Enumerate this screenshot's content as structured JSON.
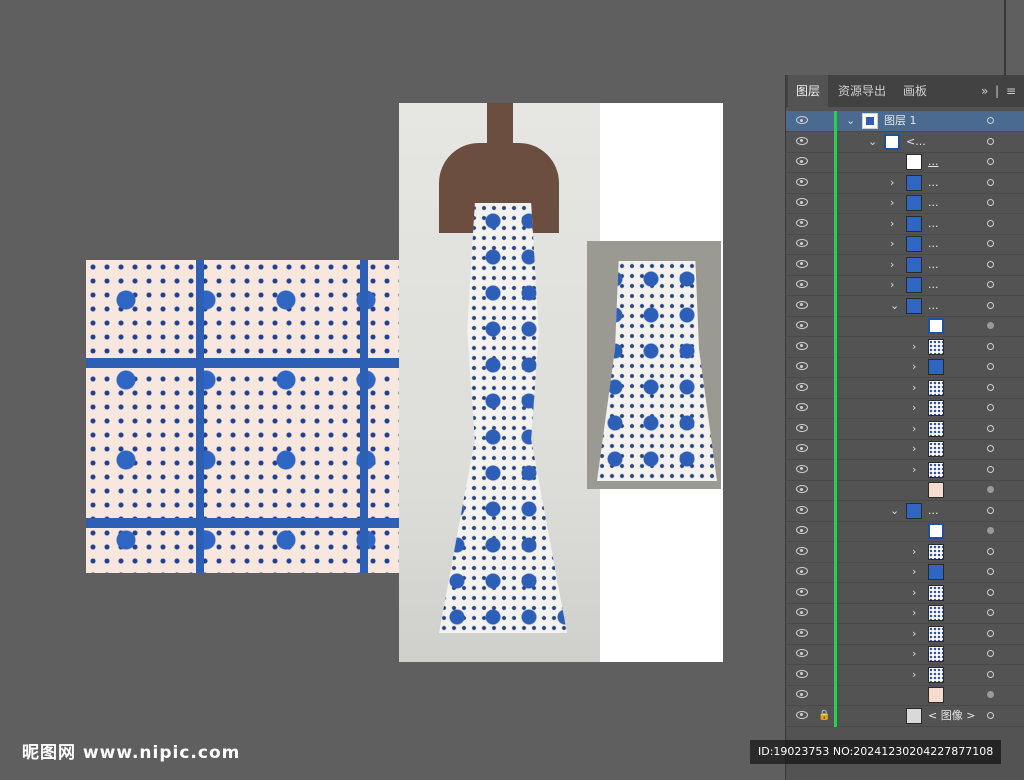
{
  "panel": {
    "tabs": [
      "图层",
      "资源导出",
      "画板"
    ],
    "active_tab": "图层",
    "menu_expand": "»",
    "menu_sep": "|",
    "menu_icon": "≡"
  },
  "layers": [
    {
      "indent": 0,
      "chev": "⌄",
      "thumb": "layer",
      "name": "图层  1",
      "selected": true,
      "target": "ring"
    },
    {
      "indent": 1,
      "chev": "⌄",
      "thumb": "group",
      "name": "<...",
      "target": "ring"
    },
    {
      "indent": 2,
      "chev": "",
      "thumb": "white",
      "name": "...",
      "underline": true,
      "target": "ring"
    },
    {
      "indent": 2,
      "chev": "›",
      "thumb": "blue",
      "name": "...",
      "target": "ring"
    },
    {
      "indent": 2,
      "chev": "›",
      "thumb": "blue",
      "name": "...",
      "target": "ring"
    },
    {
      "indent": 2,
      "chev": "›",
      "thumb": "blue",
      "name": "...",
      "target": "ring"
    },
    {
      "indent": 2,
      "chev": "›",
      "thumb": "blue",
      "name": "...",
      "target": "ring"
    },
    {
      "indent": 2,
      "chev": "›",
      "thumb": "blue",
      "name": "...",
      "target": "ring"
    },
    {
      "indent": 2,
      "chev": "›",
      "thumb": "blue",
      "name": "...",
      "target": "ring"
    },
    {
      "indent": 2,
      "chev": "⌄",
      "thumb": "blue",
      "name": "...",
      "target": "ring"
    },
    {
      "indent": 3,
      "chev": "",
      "thumb": "group",
      "name": "",
      "target": "filled"
    },
    {
      "indent": 3,
      "chev": "›",
      "thumb": "dots",
      "name": "",
      "target": "ring"
    },
    {
      "indent": 3,
      "chev": "›",
      "thumb": "blue",
      "name": "",
      "target": "ring"
    },
    {
      "indent": 3,
      "chev": "›",
      "thumb": "dots",
      "name": "",
      "target": "ring"
    },
    {
      "indent": 3,
      "chev": "›",
      "thumb": "dots",
      "name": "",
      "target": "ring"
    },
    {
      "indent": 3,
      "chev": "›",
      "thumb": "dots",
      "name": "",
      "target": "ring"
    },
    {
      "indent": 3,
      "chev": "›",
      "thumb": "dots",
      "name": "",
      "target": "ring"
    },
    {
      "indent": 3,
      "chev": "›",
      "thumb": "dots",
      "name": "",
      "target": "ring"
    },
    {
      "indent": 3,
      "chev": "",
      "thumb": "peach",
      "name": "",
      "target": "filled"
    },
    {
      "indent": 2,
      "chev": "⌄",
      "thumb": "blue",
      "name": "...",
      "target": "ring"
    },
    {
      "indent": 3,
      "chev": "",
      "thumb": "group",
      "name": "",
      "target": "filled"
    },
    {
      "indent": 3,
      "chev": "›",
      "thumb": "dots",
      "name": "",
      "target": "ring"
    },
    {
      "indent": 3,
      "chev": "›",
      "thumb": "blue",
      "name": "",
      "target": "ring"
    },
    {
      "indent": 3,
      "chev": "›",
      "thumb": "dots",
      "name": "",
      "target": "ring"
    },
    {
      "indent": 3,
      "chev": "›",
      "thumb": "dots",
      "name": "",
      "target": "ring"
    },
    {
      "indent": 3,
      "chev": "›",
      "thumb": "dots",
      "name": "",
      "target": "ring"
    },
    {
      "indent": 3,
      "chev": "›",
      "thumb": "dots",
      "name": "",
      "target": "ring"
    },
    {
      "indent": 3,
      "chev": "›",
      "thumb": "dots",
      "name": "",
      "target": "ring"
    },
    {
      "indent": 3,
      "chev": "",
      "thumb": "peach",
      "name": "",
      "target": "filled"
    },
    {
      "indent": 2,
      "chev": "",
      "thumb": "img",
      "name": "< 图像 >",
      "locked": true,
      "target": "ring"
    }
  ],
  "watermark": {
    "left": "昵图网 www.nipic.com",
    "right": "ID:19023753 NO:20241230204227877108"
  },
  "colors": {
    "accent_green": "#25d24a",
    "selection": "#4a6a8f",
    "pattern_blue": "#2f66c4",
    "pattern_bg": "#f7e7df"
  }
}
